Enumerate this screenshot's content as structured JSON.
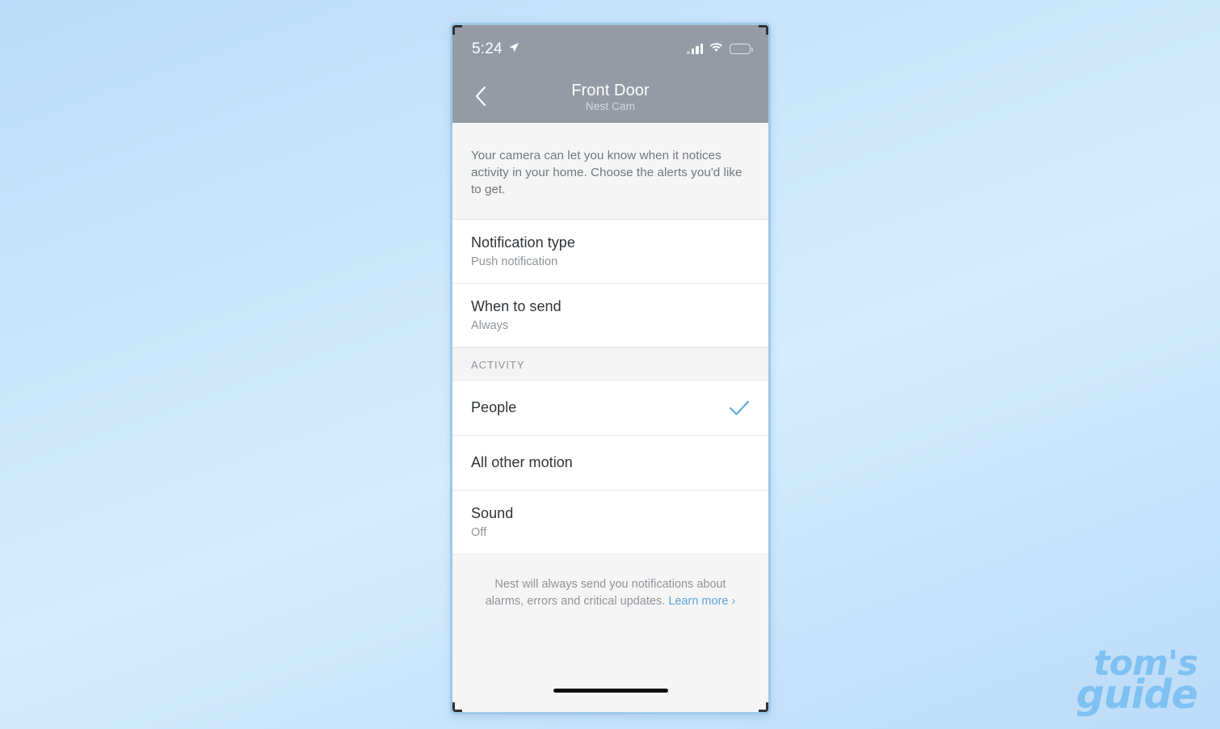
{
  "background": {
    "gradient_from": "#bedcf7",
    "gradient_to": "#bddcf8"
  },
  "watermark": {
    "line1": "tom's",
    "line2": "guide",
    "color": "#7ec1f2"
  },
  "phone": {
    "status_bar": {
      "time": "5:24",
      "location_icon": "location-arrow-icon",
      "signal_icon": "cellular-signal-icon",
      "wifi_icon": "wifi-icon",
      "battery_icon": "battery-full-icon",
      "background": "#949ba5"
    },
    "nav": {
      "back_icon": "chevron-left-icon",
      "title": "Front Door",
      "subtitle": "Nest Cam"
    },
    "intro_text": "Your camera can let you know when it notices activity in your home. Choose the alerts you'd like to get.",
    "settings_rows": [
      {
        "title": "Notification type",
        "subtitle": "Push notification"
      },
      {
        "title": "When to send",
        "subtitle": "Always"
      }
    ],
    "activity_section": {
      "header": "ACTIVITY",
      "items": [
        {
          "title": "People",
          "subtitle": "",
          "checked": true
        },
        {
          "title": "All other motion",
          "subtitle": "",
          "checked": false
        },
        {
          "title": "Sound",
          "subtitle": "Off",
          "checked": false
        }
      ],
      "check_icon": "checkmark-icon",
      "check_color": "#5ba8e0"
    },
    "footer": {
      "text": "Nest will always send you notifications about alarms, errors and critical updates.",
      "link_label": "Learn more ",
      "link_chevron": "›",
      "link_color": "#5ba3dd"
    },
    "home_indicator": "home-indicator-bar"
  }
}
